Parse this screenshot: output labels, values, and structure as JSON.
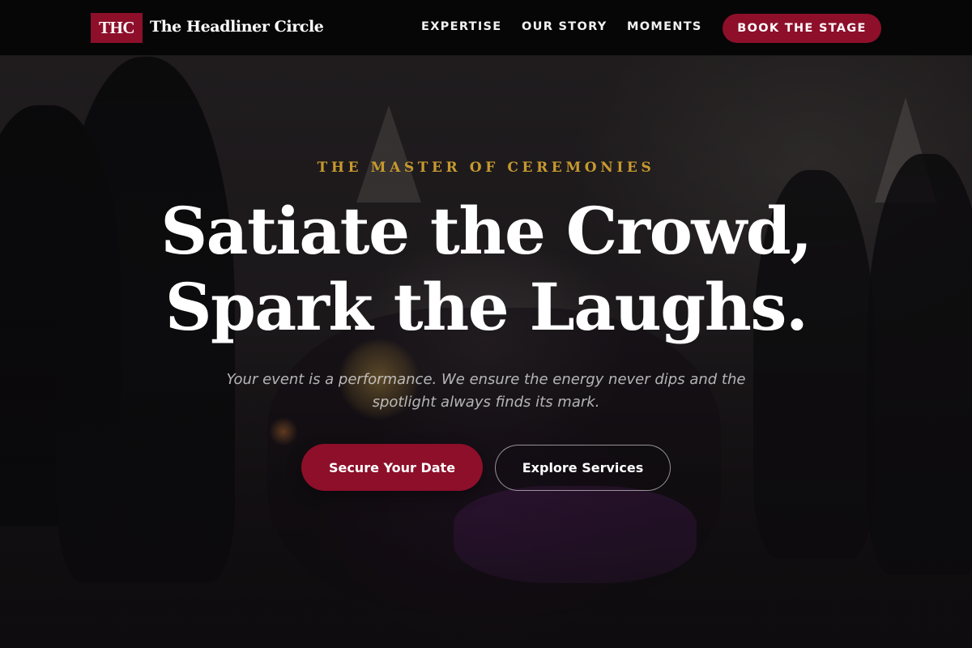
{
  "brand": {
    "logo_text": "THC",
    "name": "The Headliner Circle"
  },
  "nav": {
    "items": [
      {
        "label": "EXPERTISE"
      },
      {
        "label": "OUR STORY"
      },
      {
        "label": "MOMENTS"
      }
    ],
    "cta_label": "BOOK THE STAGE"
  },
  "hero": {
    "eyebrow": "THE MASTER OF CEREMONIES",
    "headline_line1": "Satiate the Crowd,",
    "headline_line2": "Spark the Laughs.",
    "subtitle": "Your event is a performance. We ensure the energy never dips and the spotlight always finds its mark.",
    "primary_button": "Secure Your Date",
    "secondary_button": "Explore Services"
  },
  "colors": {
    "accent": "#8d0f2a",
    "eyebrow_gold": "#c79a2f",
    "header_bg": "#060607"
  }
}
